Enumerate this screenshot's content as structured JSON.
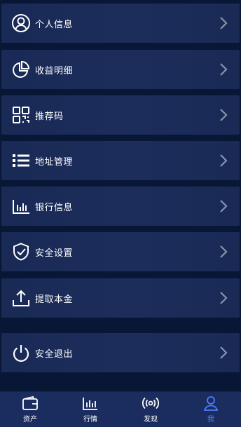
{
  "menu": {
    "items": [
      {
        "label": "个人信息",
        "icon": "user-circle-icon"
      },
      {
        "label": "收益明细",
        "icon": "pie-chart-icon"
      },
      {
        "label": "推荐码",
        "icon": "qr-code-icon"
      },
      {
        "label": "地址管理",
        "icon": "list-icon"
      },
      {
        "label": "银行信息",
        "icon": "bar-chart-icon"
      },
      {
        "label": "安全设置",
        "icon": "shield-check-icon"
      },
      {
        "label": "提取本金",
        "icon": "upload-tray-icon"
      },
      {
        "label": "安全退出",
        "icon": "power-icon"
      }
    ]
  },
  "tabbar": {
    "tabs": [
      {
        "label": "资产",
        "icon": "wallet-icon"
      },
      {
        "label": "行情",
        "icon": "bar-chart-icon"
      },
      {
        "label": "发现",
        "icon": "broadcast-icon"
      },
      {
        "label": "我",
        "icon": "person-icon"
      }
    ],
    "active": "我"
  },
  "colors": {
    "background": "#071735",
    "item": "#1b2b58",
    "active_tab": "#4d7cff",
    "chevron": "#8a93a8"
  }
}
